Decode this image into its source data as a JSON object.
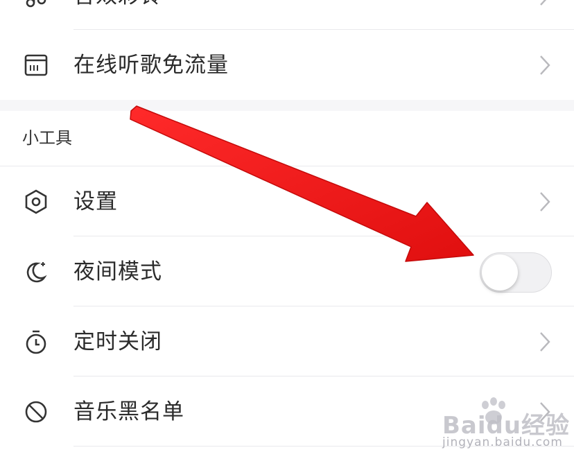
{
  "items_top": [
    {
      "label": "音效彩铃",
      "icon": "ringtone-icon"
    },
    {
      "label": "在线听歌免流量",
      "icon": "sim-card-icon"
    }
  ],
  "section": {
    "title": "小工具"
  },
  "tools": [
    {
      "label": "设置",
      "icon": "settings-hexagon-icon"
    },
    {
      "label": "夜间模式",
      "icon": "moon-stars-icon",
      "toggle": "off"
    },
    {
      "label": "定时关闭",
      "icon": "timer-icon"
    },
    {
      "label": "音乐黑名单",
      "icon": "block-icon"
    }
  ],
  "watermark": {
    "brand": "Baidu经验",
    "url": "jingyan.baidu.com"
  },
  "colors": {
    "background": "#ffffff",
    "section_gap": "#f6f6f8",
    "divider": "#e9e9ec",
    "annotation_arrow": "#f01414"
  }
}
